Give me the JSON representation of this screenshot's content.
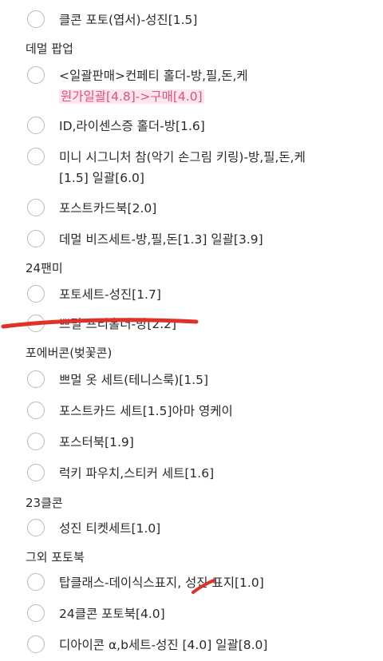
{
  "sections": [
    {
      "title": "데멀 팝업"
    },
    {
      "title": "24팬미"
    },
    {
      "title": "포에버콘(벚꽃콘)"
    },
    {
      "title": "23클콘"
    },
    {
      "title": "그외 포토북"
    }
  ],
  "items": [
    {
      "label": "클콘 포토(엽서)-성진[1.5]"
    },
    {
      "label": "<일괄판매>컨페티 홀더-방,필,돈,케",
      "note": "원가일괄[4.8]->구매[4.0]"
    },
    {
      "label": "ID,라이센스증 홀더-방[1.6]"
    },
    {
      "line1": "미니 시그니처 참(악기 손그림 키링)-방,필,돈,케",
      "line2": "[1.5] 일괄[6.0]"
    },
    {
      "label": "포스트카드북[2.0]"
    },
    {
      "label": "데멀 비즈세트-방,필,돈[1.3] 일괄[3.9]"
    },
    {
      "label": "포토세트-성진[1.7]"
    },
    {
      "label": "쁘멀 프리홀더-방[2.2]"
    },
    {
      "label": "쁘멀 옷 세트(테니스룩)[1.5]"
    },
    {
      "label": "포스트카드 세트[1.5]아마 영케이"
    },
    {
      "label": "포스터북[1.9]"
    },
    {
      "label": "럭키 파우치,스티커 세트[1.6]"
    },
    {
      "label": "성진 티켓세트[1.0]"
    },
    {
      "label": "탑클래스-데이식스표지, 성진 표지[1.0]"
    },
    {
      "label": "24클콘 포토북[4.0]"
    },
    {
      "label": "디아이콘 α,b세트-성진 [4.0] 일괄[8.0]"
    }
  ],
  "colors": {
    "highlight_text": "#e2507d",
    "highlight_bg": "#fde7ef",
    "strike": "#e0302a"
  }
}
